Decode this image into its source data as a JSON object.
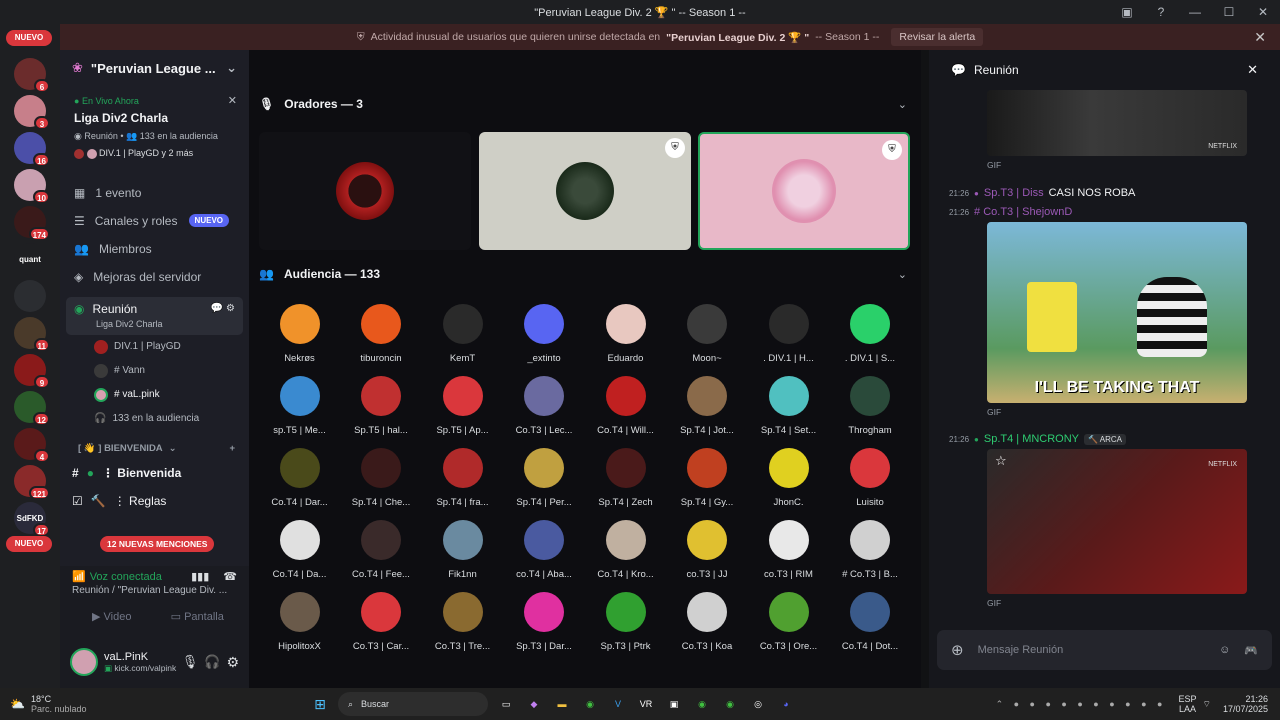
{
  "window": {
    "title": "\"Peruvian League Div. 2 🏆 \" -- Season 1 --"
  },
  "guilds": {
    "nuevo_top": "NUEVO",
    "nuevo_bottom": "NUEVO",
    "items": [
      {
        "badge": "6",
        "color": "#6b2c2c",
        "icon": "server-icon"
      },
      {
        "badge": "3",
        "color": "#c77f8a",
        "icon": "server-icon"
      },
      {
        "badge": "16",
        "color": "#4b4fa8",
        "icon": "server-icon"
      },
      {
        "badge": "10",
        "color": "#c9a0b0",
        "icon": "server-icon"
      },
      {
        "badge": "174",
        "color": "#3a1a1a",
        "icon": "server-icon"
      },
      {
        "badge": "",
        "label": "quant",
        "color": "#1e1f22",
        "icon": "quant-icon"
      },
      {
        "badge": "",
        "color": "#2b2d31",
        "icon": "discord-icon"
      },
      {
        "badge": "11",
        "color": "#4a3a2a",
        "icon": "server-icon"
      },
      {
        "badge": "9",
        "color": "#8a1a1a",
        "icon": "server-icon"
      },
      {
        "badge": "12",
        "color": "#2a5a2a",
        "icon": "server-icon"
      },
      {
        "badge": "4",
        "color": "#5a1a1a",
        "icon": "server-icon"
      },
      {
        "badge": "121",
        "color": "#8a2a2a",
        "icon": "server-icon"
      },
      {
        "badge": "17",
        "label": "SdFKD",
        "color": "#2a2a3a",
        "icon": "server-icon"
      }
    ]
  },
  "alert": {
    "prefix": "Actividad inusual de usuarios que quieren unirse detectada en",
    "server": "\"Peruvian League Div. 2 🏆 \"",
    "suffix": "-- Season 1 --",
    "action": "Revisar la alerta"
  },
  "sidebar": {
    "server_name": "\"Peruvian League ...",
    "live": {
      "status": "En Vivo Ahora",
      "title": "Liga Div2 Charla",
      "meta_channel": "Reunión",
      "meta_audience": "133 en la audiencia",
      "speakers": "DIV.1 | PlayGD y 2 más"
    },
    "menu": [
      {
        "label": "1 evento",
        "icon": "calendar-icon"
      },
      {
        "label": "Canales y roles",
        "icon": "channels-icon",
        "tag": "NUEVO"
      },
      {
        "label": "Miembros",
        "icon": "members-icon"
      },
      {
        "label": "Mejoras del servidor",
        "icon": "boost-icon"
      }
    ],
    "voice_channel": {
      "name": "Reunión",
      "subtitle": "Liga Div2 Charla"
    },
    "voice_users": [
      "DIV.1 | PlayGD",
      "# Vann",
      "# vaL.pink"
    ],
    "audience_line": "133 en la audiencia",
    "category": "[ 👋 ] BIENVENIDA",
    "text_channels": [
      "⋮ Bienvenida",
      "⋮ Reglas"
    ],
    "mentions": "12 NUEVAS MENCIONES"
  },
  "voicebar": {
    "status": "Voz conectada",
    "location": "Reunión / \"Peruvian League Div. ...",
    "video": "Video",
    "screen": "Pantalla"
  },
  "user": {
    "name": "vaL.PinK",
    "status": "kick.com/valpink"
  },
  "stage": {
    "speakers_header": "Oradores — 3",
    "audience_header": "Audiencia — 133",
    "audience": [
      {
        "name": "Nekrøs",
        "color": "#f0922a"
      },
      {
        "name": "tiburoncin",
        "color": "#e8581c"
      },
      {
        "name": "KemT",
        "color": "#2a2a2a"
      },
      {
        "name": "_extinto",
        "color": "#5865f2"
      },
      {
        "name": "Eduardo",
        "color": "#e8c8c0"
      },
      {
        "name": "Moon~",
        "color": "#3a3a3a"
      },
      {
        "name": ". DIV.1 | H...",
        "color": "#2a2a2a"
      },
      {
        "name": ". DIV.1 | S...",
        "color": "#2ad06a"
      },
      {
        "name": "sp.T5 | Me...",
        "color": "#3a8ad0"
      },
      {
        "name": "Sp.T5 | hal...",
        "color": "#c03030"
      },
      {
        "name": "Sp.T5 | Ap...",
        "color": "#da373c"
      },
      {
        "name": "Co.T3 | Lec...",
        "color": "#6a6aa0"
      },
      {
        "name": "Co.T4 | Will...",
        "color": "#c02020"
      },
      {
        "name": "Sp.T4 | Jot...",
        "color": "#8a6a4a"
      },
      {
        "name": "Sp.T4 | Set...",
        "color": "#50c0c0"
      },
      {
        "name": "Throgham",
        "color": "#2a4a3a"
      },
      {
        "name": "Co.T4 | Dar...",
        "color": "#4a4a1a"
      },
      {
        "name": "Sp.T4 | Che...",
        "color": "#3a1a1a"
      },
      {
        "name": "Sp.T4 | fra...",
        "color": "#b02a2a"
      },
      {
        "name": "Sp.T4 | Per...",
        "color": "#c0a040"
      },
      {
        "name": "Sp.T4 | Zech",
        "color": "#4a1a1a"
      },
      {
        "name": "Sp.T4 | Gy...",
        "color": "#c04020"
      },
      {
        "name": "JhonC.",
        "color": "#e0d020"
      },
      {
        "name": "Luisito",
        "color": "#da373c"
      },
      {
        "name": "Co.T4 | Da...",
        "color": "#e0e0e0"
      },
      {
        "name": "Co.T4 | Fee...",
        "color": "#3a2a2a"
      },
      {
        "name": "Fik1nn",
        "color": "#6a8aa0"
      },
      {
        "name": "co.T4 | Aba...",
        "color": "#4a5aa0"
      },
      {
        "name": "Co.T4 | Kro...",
        "color": "#c0b0a0"
      },
      {
        "name": "co.T3 | JJ",
        "color": "#e0c030"
      },
      {
        "name": "co.T3 | RIM",
        "color": "#e8e8e8"
      },
      {
        "name": "# Co.T3 | B...",
        "color": "#d0d0d0"
      },
      {
        "name": "HipolitoxX",
        "color": "#6a5a4a"
      },
      {
        "name": "Co.T3 | Car...",
        "color": "#da373c"
      },
      {
        "name": "Co.T3 | Tre...",
        "color": "#8a6a30"
      },
      {
        "name": "Sp.T3 | Dar...",
        "color": "#e030a0"
      },
      {
        "name": "Sp.T3 | Ptrk",
        "color": "#30a030"
      },
      {
        "name": "Co.T3 | Koa",
        "color": "#d0d0d0"
      },
      {
        "name": "Co.T3 | Ore...",
        "color": "#50a030"
      },
      {
        "name": "Co.T4 | Dot...",
        "color": "#3a5a8a"
      }
    ]
  },
  "chat": {
    "title": "Reunión",
    "gif_label": "GIF",
    "netflix": "NETFLIX",
    "messages": [
      {
        "time": "21:26",
        "user": "Sp.T3 | Diss",
        "text": "CASI NOS ROBA"
      },
      {
        "time": "21:26",
        "user": "# Co.T3 | ShejownD",
        "text": ""
      },
      {
        "time": "21:26",
        "user": "Sp.T4 | MNCRONY",
        "tag": "ARCA"
      }
    ],
    "gif_caption": "I'LL BE TAKING THAT",
    "input_placeholder": "Mensaje Reunión"
  },
  "taskbar": {
    "weather_temp": "18°C",
    "weather_desc": "Parc. nublado",
    "search": "Buscar",
    "lang1": "ESP",
    "lang2": "LAA",
    "time": "21:26",
    "date": "17/07/2025"
  }
}
